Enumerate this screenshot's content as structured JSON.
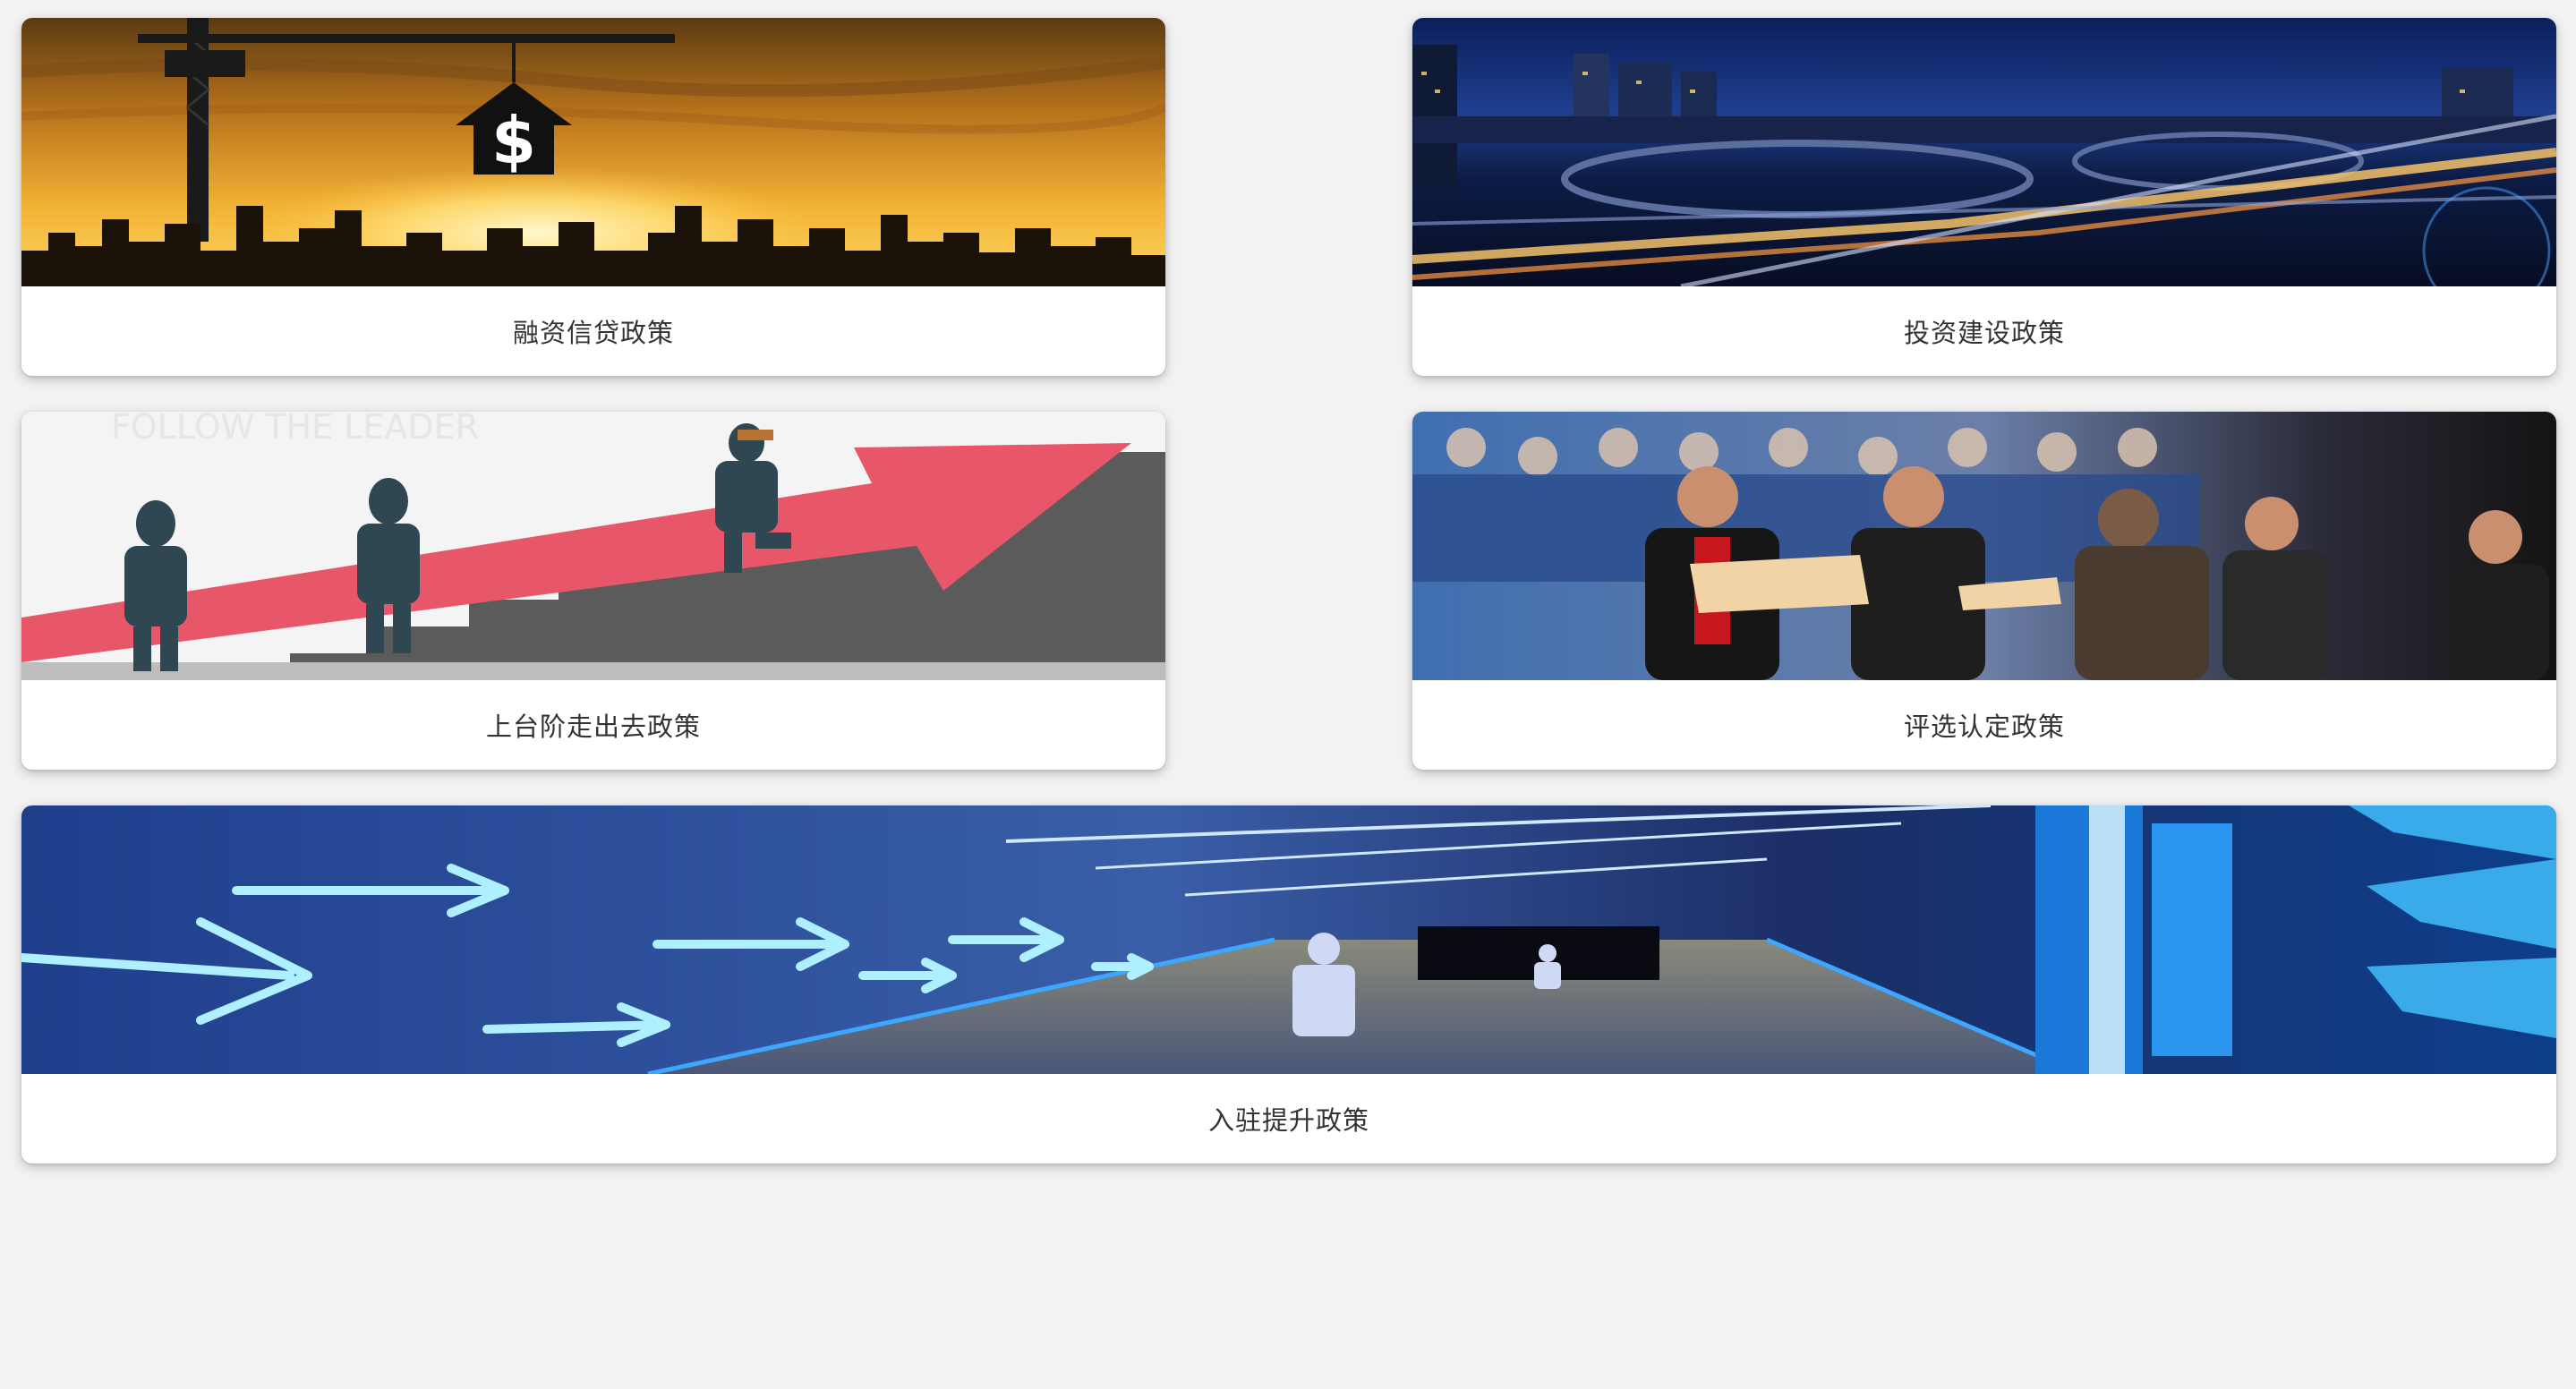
{
  "cards": [
    {
      "label": "融资信贷政策",
      "image": "finance-crane-house-image"
    },
    {
      "label": "投资建设政策",
      "image": "night-city-highway-image"
    },
    {
      "label": "上台阶走出去政策",
      "image": "follow-the-leader-stairs-image",
      "image_text": "FOLLOW THE LEADER"
    },
    {
      "label": "评选认定政策",
      "image": "award-ceremony-image"
    },
    {
      "label": "入驻提升政策",
      "image": "futuristic-corridor-arrows-image"
    }
  ],
  "colors": {
    "page_background": "#f2f2f2",
    "card_background": "#ffffff",
    "label_text": "#333333"
  }
}
